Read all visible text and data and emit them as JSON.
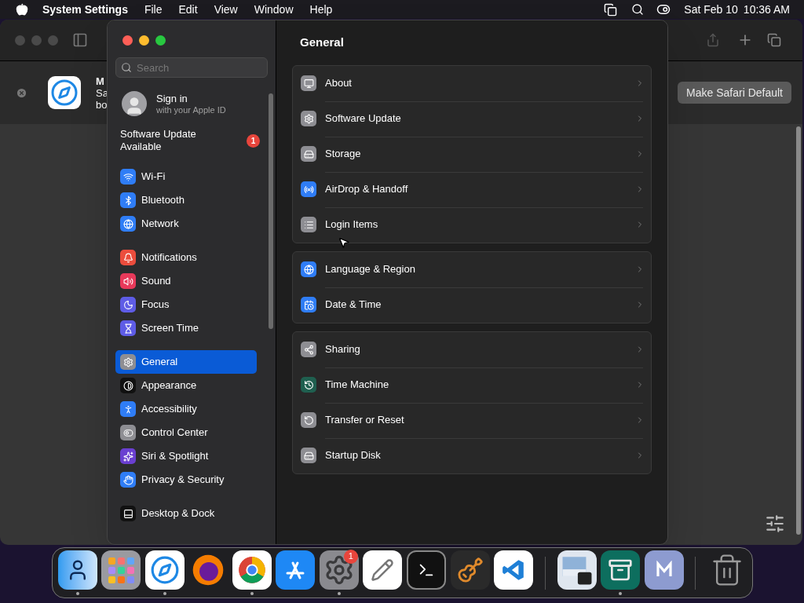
{
  "menubar": {
    "app": "System Settings",
    "menus": [
      "File",
      "Edit",
      "View",
      "Window",
      "Help"
    ],
    "date": "Sat Feb 10",
    "time": "10:36 AM"
  },
  "safari": {
    "banner_title": "M",
    "banner_line_1": "Sa",
    "banner_line_2": "bo",
    "default_button": "Make Safari Default"
  },
  "settings": {
    "search": {
      "placeholder": "Search"
    },
    "account": {
      "title": "Sign in",
      "subtitle": "with your Apple ID"
    },
    "update_notice": {
      "label": "Software Update Available",
      "badge": "1"
    },
    "sidebar_groups": [
      {
        "items": [
          {
            "label": "Wi-Fi",
            "selected": false
          },
          {
            "label": "Bluetooth",
            "selected": false
          },
          {
            "label": "Network",
            "selected": false
          }
        ]
      },
      {
        "items": [
          {
            "label": "Notifications",
            "selected": false
          },
          {
            "label": "Sound",
            "selected": false
          },
          {
            "label": "Focus",
            "selected": false
          },
          {
            "label": "Screen Time",
            "selected": false
          }
        ]
      },
      {
        "items": [
          {
            "label": "General",
            "selected": true
          },
          {
            "label": "Appearance",
            "selected": false
          },
          {
            "label": "Accessibility",
            "selected": false
          },
          {
            "label": "Control Center",
            "selected": false
          },
          {
            "label": "Siri & Spotlight",
            "selected": false
          },
          {
            "label": "Privacy & Security",
            "selected": false
          }
        ]
      },
      {
        "items": [
          {
            "label": "Desktop & Dock",
            "selected": false
          }
        ]
      }
    ],
    "title": "General",
    "groups": [
      {
        "rows": [
          {
            "label": "About"
          },
          {
            "label": "Software Update"
          },
          {
            "label": "Storage"
          },
          {
            "label": "AirDrop & Handoff"
          },
          {
            "label": "Login Items"
          }
        ]
      },
      {
        "rows": [
          {
            "label": "Language & Region"
          },
          {
            "label": "Date & Time"
          }
        ]
      },
      {
        "rows": [
          {
            "label": "Sharing"
          },
          {
            "label": "Time Machine"
          },
          {
            "label": "Transfer or Reset"
          },
          {
            "label": "Startup Disk"
          }
        ]
      }
    ]
  },
  "dock": {
    "sections": [
      {
        "items": [
          {
            "running": true
          },
          {
            "running": false
          },
          {
            "running": true
          },
          {
            "running": false
          },
          {
            "running": true
          },
          {
            "running": false
          },
          {
            "running": true,
            "badge": "1"
          },
          {
            "running": false
          },
          {
            "running": false
          },
          {
            "running": false
          },
          {
            "running": false
          }
        ]
      },
      {
        "items": [
          {
            "running": false
          },
          {
            "running": true
          },
          {
            "running": false
          }
        ]
      },
      {
        "items": [
          {
            "running": false
          }
        ]
      }
    ]
  }
}
